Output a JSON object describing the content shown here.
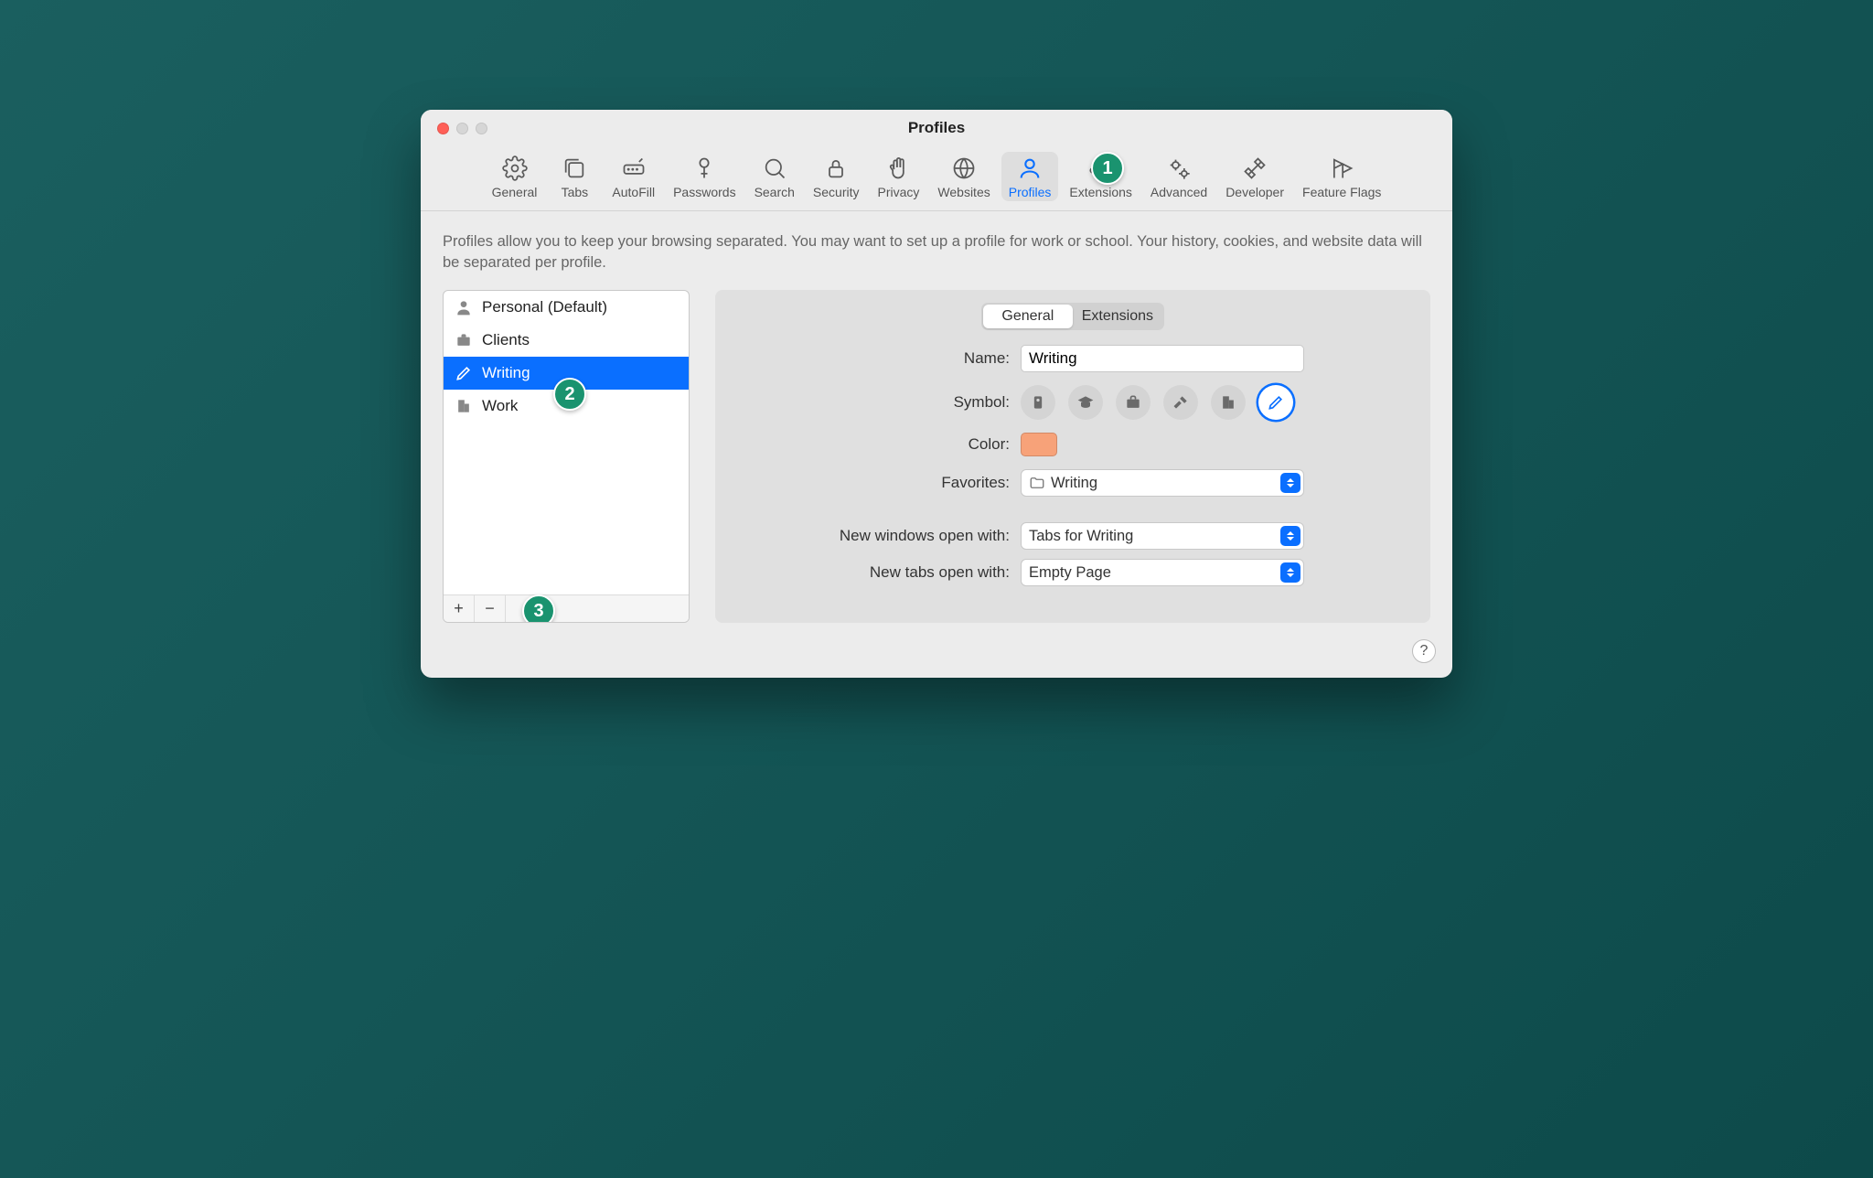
{
  "window_title": "Profiles",
  "toolbar": {
    "items": [
      {
        "label": "General"
      },
      {
        "label": "Tabs"
      },
      {
        "label": "AutoFill"
      },
      {
        "label": "Passwords"
      },
      {
        "label": "Search"
      },
      {
        "label": "Security"
      },
      {
        "label": "Privacy"
      },
      {
        "label": "Websites"
      },
      {
        "label": "Profiles"
      },
      {
        "label": "Extensions"
      },
      {
        "label": "Advanced"
      },
      {
        "label": "Developer"
      },
      {
        "label": "Feature Flags"
      }
    ]
  },
  "description": "Profiles allow you to keep your browsing separated. You may want to set up a profile for work or school. Your history, cookies, and website data will be separated per profile.",
  "profiles": {
    "items": [
      {
        "label": "Personal (Default)"
      },
      {
        "label": "Clients"
      },
      {
        "label": "Writing"
      },
      {
        "label": "Work"
      }
    ],
    "add": "+",
    "remove": "−"
  },
  "detail": {
    "seg_general": "General",
    "seg_extensions": "Extensions",
    "labels": {
      "name": "Name:",
      "symbol": "Symbol:",
      "color": "Color:",
      "favorites": "Favorites:",
      "new_windows": "New windows open with:",
      "new_tabs": "New tabs open with:"
    },
    "name_value": "Writing",
    "color_value": "#f7a279",
    "favorites_value": "Writing",
    "new_windows_value": "Tabs for Writing",
    "new_tabs_value": "Empty Page"
  },
  "help": "?",
  "annotations": {
    "one": "1",
    "two": "2",
    "three": "3"
  }
}
